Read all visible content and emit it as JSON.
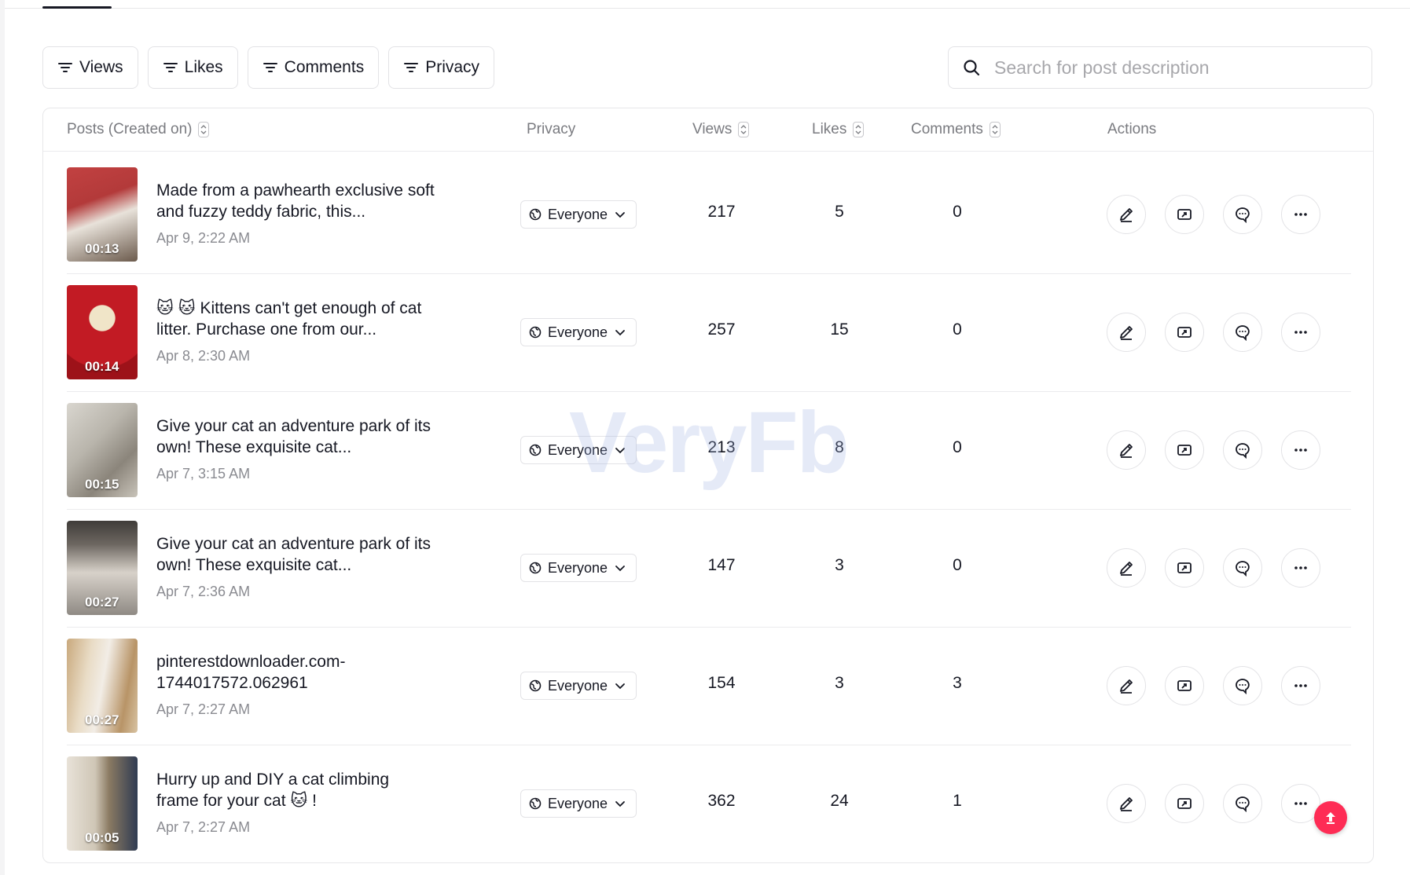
{
  "filters": {
    "views_label": "Views",
    "likes_label": "Likes",
    "comments_label": "Comments",
    "privacy_label": "Privacy"
  },
  "search": {
    "placeholder": "Search for post description"
  },
  "table": {
    "headers": {
      "posts": "Posts (Created on)",
      "privacy": "Privacy",
      "views": "Views",
      "likes": "Likes",
      "comments": "Comments",
      "actions": "Actions"
    },
    "rows": [
      {
        "description": "Made from a pawhearth exclusive soft and fuzzy teddy fabric, this...",
        "date": "Apr 9, 2:22 AM",
        "duration": "00:13",
        "privacy": "Everyone",
        "views": "217",
        "likes": "5",
        "comments": "0"
      },
      {
        "description": "🐱 🐱 Kittens can't get enough of cat litter. Purchase one from our...",
        "date": "Apr 8, 2:30 AM",
        "duration": "00:14",
        "privacy": "Everyone",
        "views": "257",
        "likes": "15",
        "comments": "0"
      },
      {
        "description": "Give your cat an adventure park of its own! These exquisite cat...",
        "date": "Apr 7, 3:15 AM",
        "duration": "00:15",
        "privacy": "Everyone",
        "views": "213",
        "likes": "8",
        "comments": "0"
      },
      {
        "description": "Give your cat an adventure park of its own! These exquisite cat...",
        "date": "Apr 7, 2:36 AM",
        "duration": "00:27",
        "privacy": "Everyone",
        "views": "147",
        "likes": "3",
        "comments": "0"
      },
      {
        "description": "pinterestdownloader.com-1744017572.062961",
        "date": "Apr 7, 2:27 AM",
        "duration": "00:27",
        "privacy": "Everyone",
        "views": "154",
        "likes": "3",
        "comments": "3"
      },
      {
        "description": "Hurry up and DIY a cat climbing frame for your cat 🐱 !",
        "date": "Apr 7, 2:27 AM",
        "duration": "00:05",
        "privacy": "Everyone",
        "views": "362",
        "likes": "24",
        "comments": "1"
      }
    ]
  },
  "watermark": "VeryFb",
  "colors": {
    "accent": "#fe2c55",
    "text": "#161823",
    "muted": "#8a8b91",
    "border": "#e3e3e6"
  },
  "icons": [
    "filter-icon",
    "search-icon",
    "sort-icon",
    "globe-icon",
    "chevron-down-icon",
    "edit-icon",
    "share-icon",
    "comment-icon",
    "more-icon",
    "arrow-up-icon"
  ]
}
